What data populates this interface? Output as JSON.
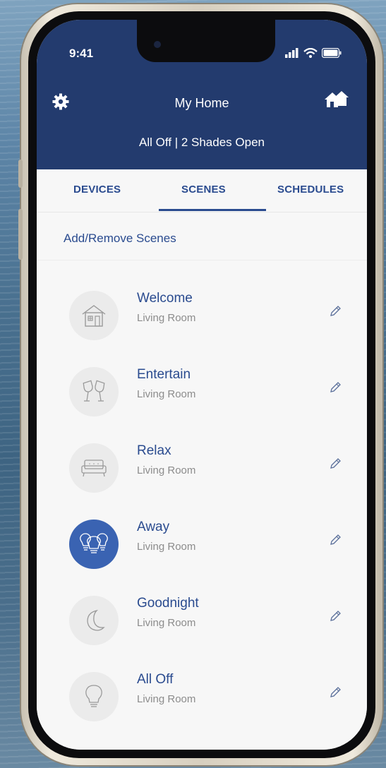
{
  "status": {
    "time": "9:41"
  },
  "header": {
    "title": "My Home",
    "subtitle": "All Off | 2 Shades Open"
  },
  "tabs": [
    {
      "label": "DEVICES"
    },
    {
      "label": "SCENES",
      "active": true
    },
    {
      "label": "SCHEDULES"
    }
  ],
  "add_remove_label": "Add/Remove Scenes",
  "scenes": [
    {
      "name": "Welcome",
      "room": "Living Room",
      "icon": "house-icon"
    },
    {
      "name": "Entertain",
      "room": "Living Room",
      "icon": "wine-glasses-icon"
    },
    {
      "name": "Relax",
      "room": "Living Room",
      "icon": "sofa-icon"
    },
    {
      "name": "Away",
      "room": "Living Room",
      "icon": "bulbs-icon",
      "active": true
    },
    {
      "name": "Goodnight",
      "room": "Living Room",
      "icon": "moon-icon"
    },
    {
      "name": "All Off",
      "room": "Living Room",
      "icon": "bulb-icon"
    }
  ],
  "colors": {
    "header_bg": "#233b6e",
    "accent": "#2a4b8f",
    "active_scene": "#3a63b2"
  }
}
